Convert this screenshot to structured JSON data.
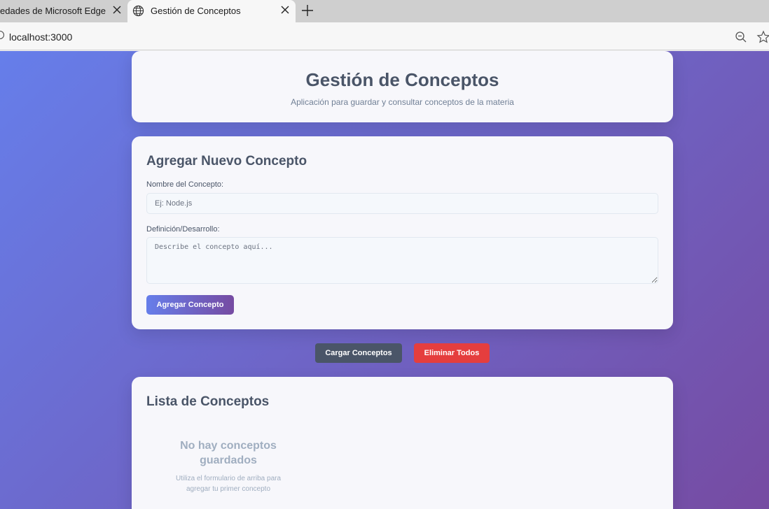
{
  "browser": {
    "tabs": [
      {
        "title": "edades de Microsoft Edge",
        "active": false
      },
      {
        "title": "Gestión de Conceptos",
        "active": true
      }
    ],
    "url": "localhost:3000"
  },
  "header": {
    "title": "Gestión de Conceptos",
    "subtitle": "Aplicación para guardar y consultar conceptos de la materia"
  },
  "form": {
    "title": "Agregar Nuevo Concepto",
    "name_label": "Nombre del Concepto:",
    "name_placeholder": "Ej: Node.js",
    "definition_label": "Definición/Desarrollo:",
    "definition_placeholder": "Describe el concepto aquí...",
    "submit_label": "Agregar Concepto"
  },
  "actions": {
    "load_label": "Cargar Conceptos",
    "delete_all_label": "Eliminar Todos"
  },
  "list": {
    "title": "Lista de Conceptos",
    "empty_title": "No hay conceptos guardados",
    "empty_text": "Utiliza el formulario de arriba para agregar tu primer concepto"
  },
  "colors": {
    "gradient_start": "#667eea",
    "gradient_end": "#764ba2",
    "load_button": "#4a5568",
    "delete_button": "#e53e3e"
  }
}
